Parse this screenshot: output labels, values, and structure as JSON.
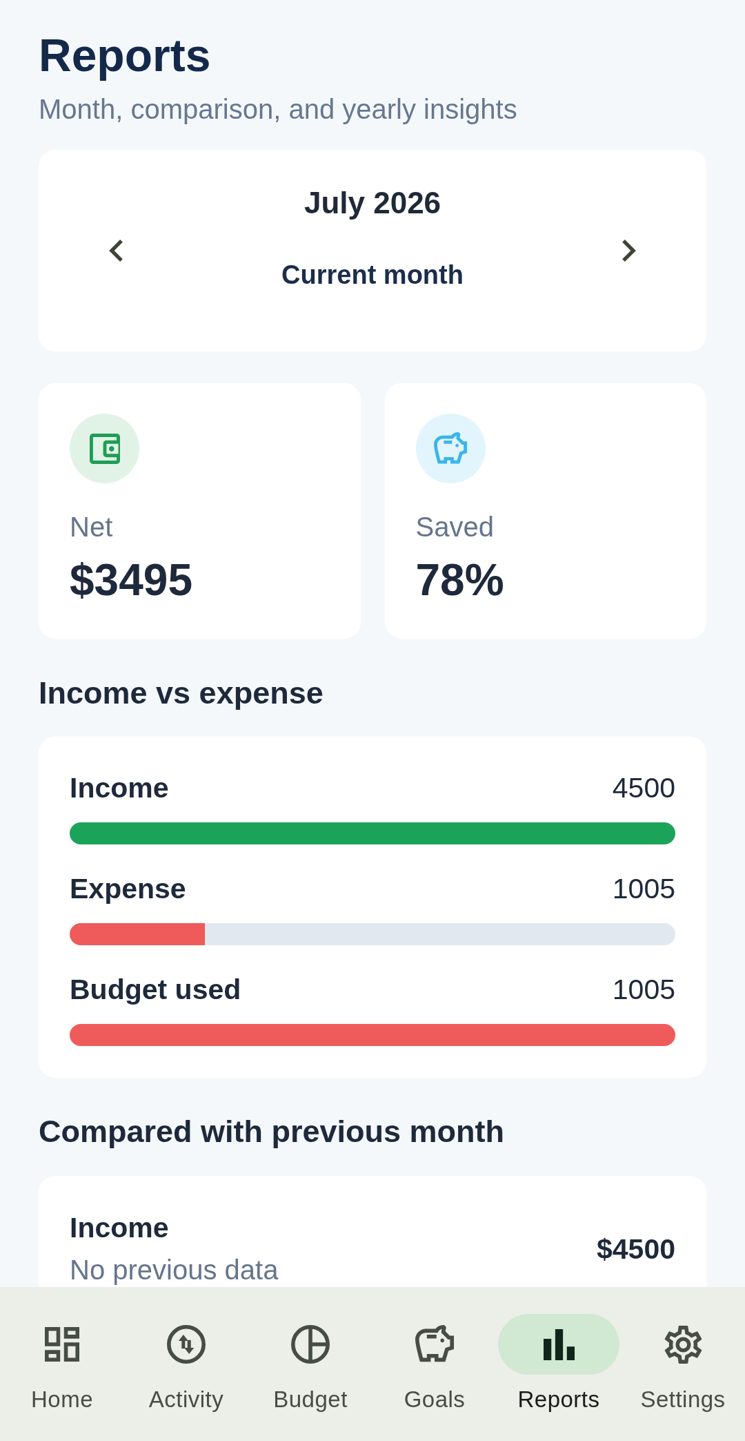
{
  "header": {
    "title": "Reports",
    "subtitle": "Month, comparison, and yearly insights"
  },
  "month_picker": {
    "month": "July 2026",
    "period_button": "Current month"
  },
  "summary_cards": [
    {
      "label": "Net",
      "value": "$3495"
    },
    {
      "label": "Saved",
      "value": "78%"
    }
  ],
  "income_vs_expense": {
    "title": "Income vs expense",
    "bars": [
      {
        "label": "Income",
        "value": "4500",
        "level": 1,
        "color": "#1ba35a"
      },
      {
        "label": "Expense",
        "value": "1005",
        "level": 0.223,
        "color": "#ef5b5b"
      },
      {
        "label": "Budget used",
        "value": "1005",
        "level": 1,
        "color": "#ef5b5b"
      }
    ]
  },
  "comparison": {
    "title": "Compared with previous month",
    "rows": [
      {
        "label": "Income",
        "note": "No previous data",
        "value": "$4500"
      }
    ]
  },
  "nav": {
    "items": [
      {
        "label": "Home",
        "selected": false
      },
      {
        "label": "Activity",
        "selected": false
      },
      {
        "label": "Budget",
        "selected": false
      },
      {
        "label": "Goals",
        "selected": false
      },
      {
        "label": "Reports",
        "selected": true
      },
      {
        "label": "Settings",
        "selected": false
      }
    ]
  }
}
